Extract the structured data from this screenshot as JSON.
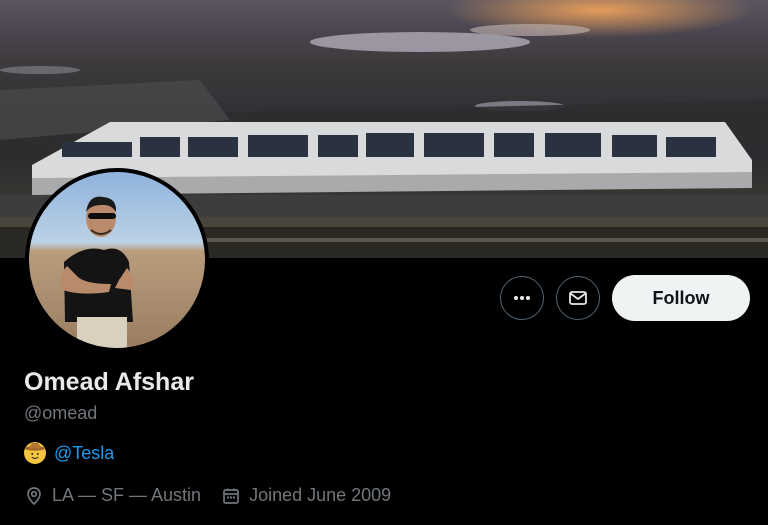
{
  "profile": {
    "display_name": "Omead Afshar",
    "handle": "@omead",
    "affiliation": "@Tesla",
    "location": "LA — SF — Austin",
    "joined": "Joined June 2009"
  },
  "actions": {
    "follow_label": "Follow",
    "more_icon": "more-horizontal-icon",
    "message_icon": "mail-icon"
  },
  "colors": {
    "background": "#000000",
    "primary_text": "#e7e9ea",
    "secondary_text": "#71767b",
    "link": "#1d9bf0",
    "follow_bg": "#eff3f4"
  }
}
